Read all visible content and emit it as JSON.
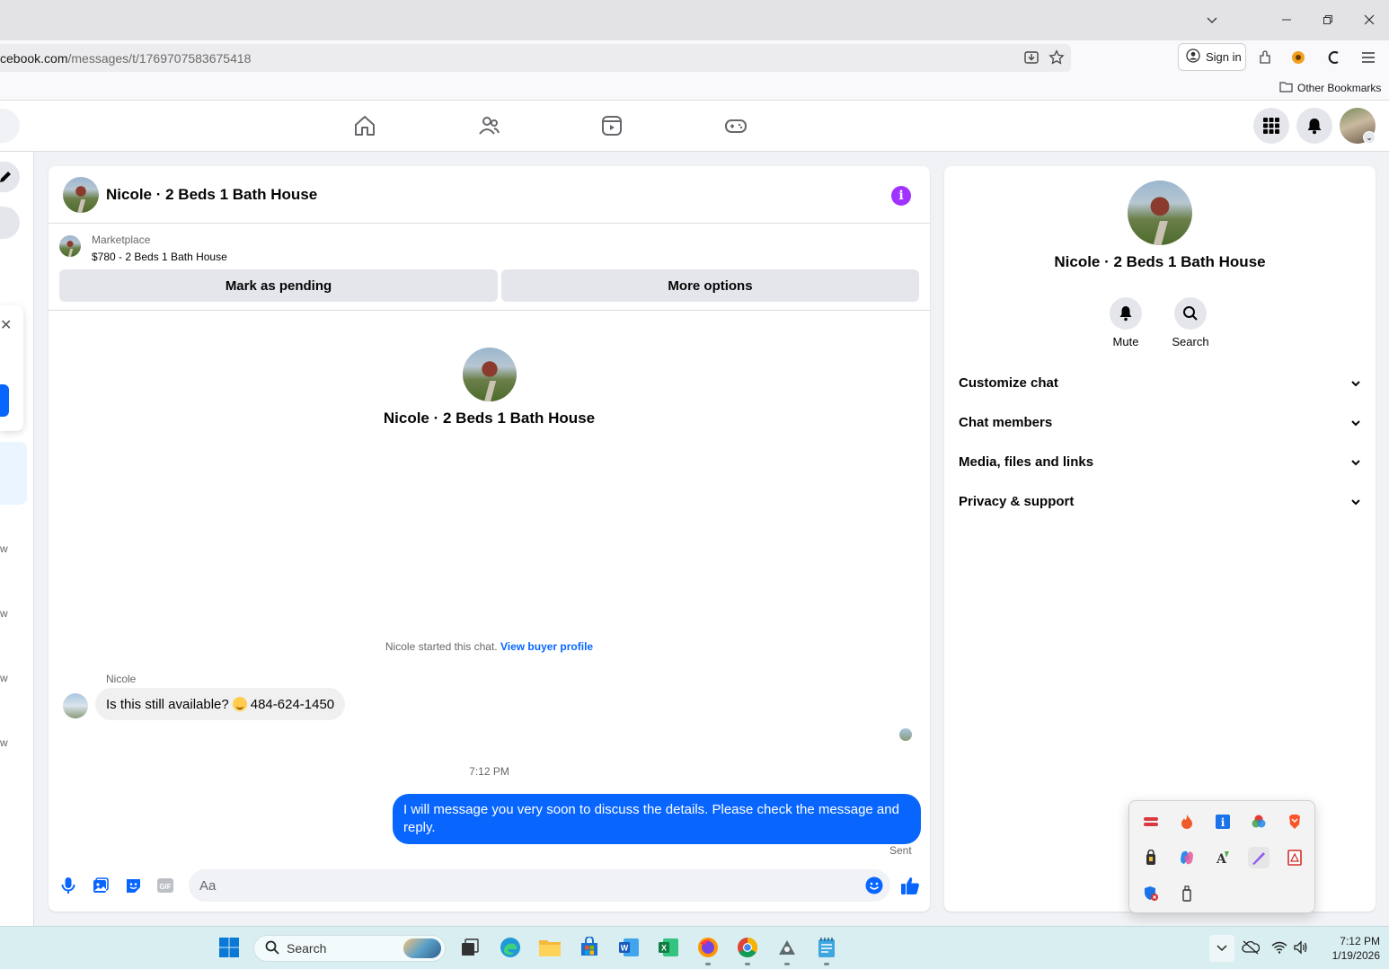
{
  "browser": {
    "url_host": "cebook.com",
    "url_path": "/messages/t/1769707583675418",
    "sign_in_label": "Sign in",
    "other_bookmarks_label": "Other Bookmarks"
  },
  "fb_nav": {
    "icons": [
      "home-icon",
      "friends-icon",
      "video-icon",
      "gaming-icon"
    ],
    "right_icons": [
      "menu-grid-icon",
      "notifications-icon",
      "profile-avatar"
    ]
  },
  "left_stub": {
    "timestamps": [
      "w",
      "w",
      "w",
      "w"
    ]
  },
  "chat": {
    "title": "Nicole · 2 Beds 1 Bath House",
    "marketplace_label": "Marketplace",
    "listing": "$780 - 2 Beds 1 Bath House",
    "mark_pending_label": "Mark as pending",
    "more_options_label": "More options",
    "center_name": "Nicole · 2 Beds 1 Bath House",
    "started_text": "Nicole started this chat. ",
    "view_buyer_profile": "View buyer profile",
    "messages": [
      {
        "sender": "Nicole",
        "text_before": "Is this still available?",
        "text_after": "484-624-1450"
      },
      {
        "text": "I will message you very soon to discuss the details. Please check the message and reply."
      }
    ],
    "timestamp": "7:12 PM",
    "sent_label": "Sent",
    "composer_placeholder": "Aa"
  },
  "details": {
    "name": "Nicole · 2 Beds 1 Bath House",
    "mute_label": "Mute",
    "search_label": "Search",
    "sections": [
      "Customize chat",
      "Chat members",
      "Media, files and links",
      "Privacy & support"
    ]
  },
  "taskbar": {
    "search_placeholder": "Search",
    "time": "7:12 PM",
    "date": "1/19/2026"
  },
  "colors": {
    "accent": "#0866ff",
    "info": "#a033ff",
    "taskbar": "#d8eef0"
  }
}
